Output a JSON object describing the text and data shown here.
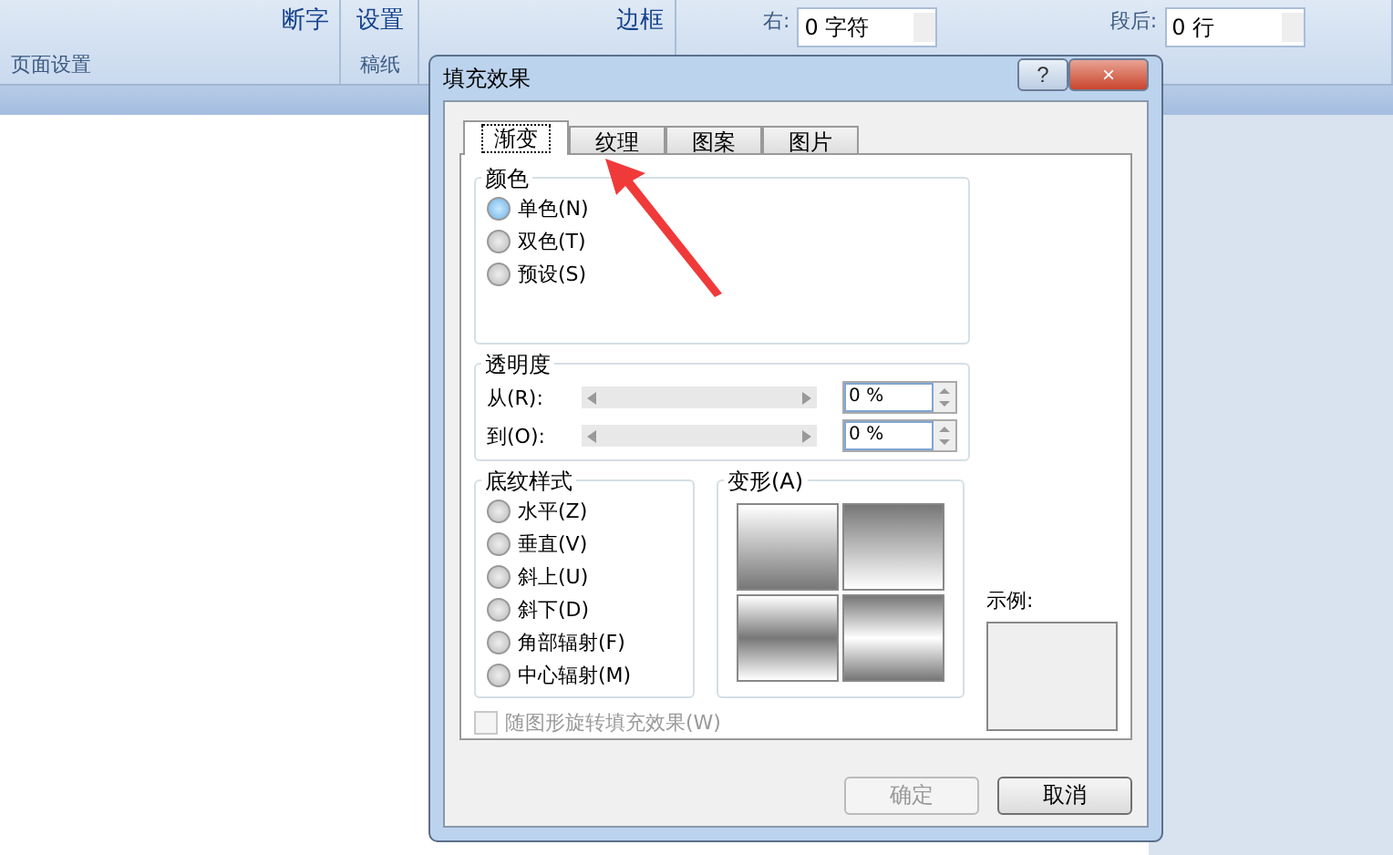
{
  "ribbon": {
    "groups": [
      {
        "label": "页面设置",
        "items": [
          "断字"
        ]
      },
      {
        "label": "稿纸",
        "items": [
          "设置"
        ]
      },
      {
        "items": [
          "边框"
        ]
      }
    ],
    "spinners": [
      {
        "label": "右:",
        "value": "0 字符"
      },
      {
        "label": "段后:",
        "value": "0 行"
      }
    ]
  },
  "dialog": {
    "title": "填充效果",
    "help": "?",
    "close": "×",
    "tabs": [
      {
        "label": "渐变",
        "selected": true
      },
      {
        "label": "纹理",
        "selected": false
      },
      {
        "label": "图案",
        "selected": false
      },
      {
        "label": "图片",
        "selected": false
      }
    ],
    "color_group": {
      "title": "颜色",
      "options": [
        {
          "label": "单色(N)",
          "selected": true
        },
        {
          "label": "双色(T)",
          "selected": false
        },
        {
          "label": "预设(S)",
          "selected": false
        }
      ]
    },
    "transparency": {
      "title": "透明度",
      "rows": [
        {
          "label": "从(R):",
          "value": "0 %"
        },
        {
          "label": "到(O):",
          "value": "0 %"
        }
      ]
    },
    "shading": {
      "title": "底纹样式",
      "options": [
        {
          "label": "水平(Z)",
          "selected": false
        },
        {
          "label": "垂直(V)",
          "selected": false
        },
        {
          "label": "斜上(U)",
          "selected": false
        },
        {
          "label": "斜下(D)",
          "selected": false
        },
        {
          "label": "角部辐射(F)",
          "selected": false
        },
        {
          "label": "中心辐射(M)",
          "selected": false
        }
      ]
    },
    "variants": {
      "title": "变形(A)"
    },
    "sample": {
      "label": "示例:"
    },
    "rotate": {
      "label": "随图形旋转填充效果(W)",
      "checked": false,
      "disabled": true
    },
    "buttons": [
      {
        "label": "确定",
        "disabled": true
      },
      {
        "label": "取消",
        "disabled": false
      }
    ]
  }
}
